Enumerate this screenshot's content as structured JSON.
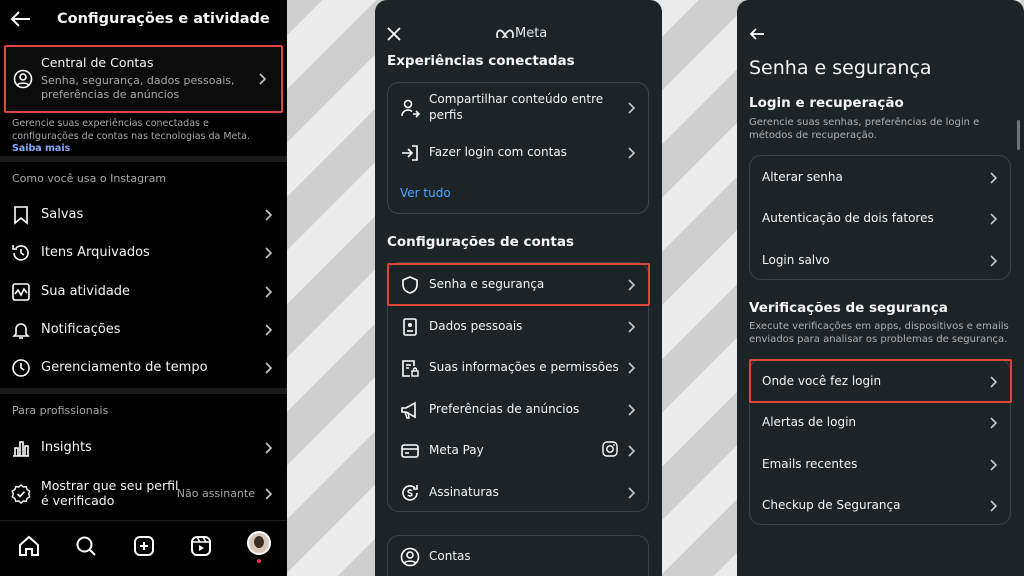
{
  "panel1": {
    "title": "Configurações e atividade",
    "account_center": {
      "title": "Central de Contas",
      "subtitle": "Senha, segurança, dados pessoais, preferências de anúncios"
    },
    "note": "Gerencie suas experiências conectadas e configurações de contas nas tecnologias da Meta.",
    "note_link": "Saiba mais",
    "section_usage": "Como você usa o Instagram",
    "items": [
      {
        "label": "Salvas",
        "icon": "bookmark-icon"
      },
      {
        "label": "Itens Arquivados",
        "icon": "archive-icon"
      },
      {
        "label": "Sua atividade",
        "icon": "activity-icon"
      },
      {
        "label": "Notificações",
        "icon": "bell-icon"
      },
      {
        "label": "Gerenciamento de tempo",
        "icon": "clock-icon"
      }
    ],
    "section_pro": "Para profissionais",
    "pro_items": [
      {
        "label": "Insights",
        "icon": "bar-chart-icon"
      },
      {
        "label": "Mostrar que seu perfil é verificado",
        "value": "Não assinante",
        "icon": "verified-icon"
      }
    ],
    "bottom_nav": [
      "home-icon",
      "search-icon",
      "create-icon",
      "reels-icon",
      "profile-avatar"
    ]
  },
  "panel2": {
    "brand": "Meta",
    "connected_title": "Experiências conectadas",
    "connected_items": [
      {
        "label": "Compartilhar conteúdo entre perfis",
        "icon": "share-user-icon"
      },
      {
        "label": "Fazer login com contas",
        "icon": "login-icon"
      }
    ],
    "see_all": "Ver tudo",
    "settings_title": "Configurações de contas",
    "settings_items": [
      {
        "label": "Senha e segurança",
        "icon": "shield-icon"
      },
      {
        "label": "Dados pessoais",
        "icon": "id-card-icon"
      },
      {
        "label": "Suas informações e permissões",
        "icon": "info-lock-icon"
      },
      {
        "label": "Preferências de anúncios",
        "icon": "megaphone-icon"
      },
      {
        "label": "Meta Pay",
        "icon": "card-icon"
      },
      {
        "label": "Assinaturas",
        "icon": "subscription-icon"
      }
    ],
    "accounts": {
      "label": "Contas",
      "icon": "user-circle-icon"
    }
  },
  "panel3": {
    "title": "Senha e segurança",
    "login_title": "Login e recuperação",
    "login_sub": "Gerencie suas senhas, preferências de login e métodos de recuperação.",
    "login_items": [
      "Alterar senha",
      "Autenticação de dois fatores",
      "Login salvo"
    ],
    "checks_title": "Verificações de segurança",
    "checks_sub": "Execute verificações em apps, dispositivos e emails enviados para analisar os problemas de segurança.",
    "checks_items": [
      "Onde você fez login",
      "Alertas de login",
      "Emails recentes",
      "Checkup de Segurança"
    ]
  },
  "colors": {
    "highlight": "#e0443a",
    "link": "#4ea6ff",
    "panel_dark": "#1c2428"
  }
}
